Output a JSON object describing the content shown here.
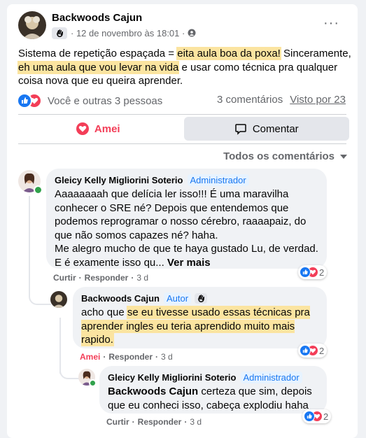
{
  "post": {
    "author": "Backwoods Cajun",
    "date": "12 de novembro às 18:01",
    "text_parts": [
      "Sistema de repetição espaçada = ",
      "eita aula boa da poxa!",
      " Sinceramente, ",
      "eh uma aula que vou levar na vida",
      " e usar como técnica pra qualquer coisa nova que eu queira aprender."
    ],
    "reactions_text": "Você e outras 3 pessoas",
    "comments_count": "3 comentários",
    "seen_by": "Visto por 23"
  },
  "actions": {
    "love_label": "Amei",
    "comment_label": "Comentar"
  },
  "sort_label": "Todos os comentários",
  "comments": [
    {
      "author": "Gleicy Kelly Migliorini Soterio",
      "role": "Administrador",
      "text_lines": [
        "Aaaaaaaah que delícia ler isso!!! É uma maravilha",
        "conhecer o SRE né? Depois que entendemos que",
        "podemos reprogramar o nosso cérebro, raaaapaiz, do",
        "que não somos capazes né? haha.",
        "Me alegro mucho de que te haya gustado Lu, de verdad.",
        "E é examente isso qu... "
      ],
      "see_more": "Ver mais",
      "like": "Curtir",
      "reply": "Responder",
      "time": "3 d",
      "reaction_count": "2"
    },
    {
      "author": "Backwoods Cajun",
      "role": "Autor",
      "text_parts": [
        "acho que ",
        "se eu tivesse usado essas técnicas pra aprender ingles eu teria aprendido muito mais rapido."
      ],
      "like": "Amei",
      "reply": "Responder",
      "time": "3 d",
      "reaction_count": "2"
    },
    {
      "author": "Gleicy Kelly Migliorini Soterio",
      "role": "Administrador",
      "mention": "Backwoods Cajun",
      "text": " certeza que sim, depois que eu conheci isso, cabeça explodiu haha",
      "like": "Curtir",
      "reply": "Responder",
      "time": "3 d",
      "reaction_count": "2"
    }
  ],
  "colors": {
    "brand": "#1877f2",
    "love": "#f33e58",
    "highlight": "#fbe4a0"
  }
}
